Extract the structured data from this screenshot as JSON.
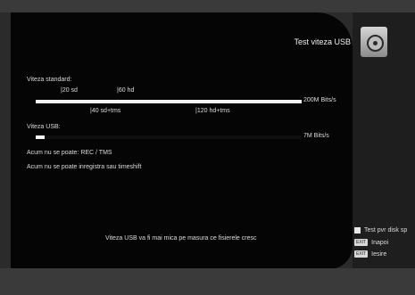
{
  "title": "Test viteza USB",
  "standard": {
    "label": "Viteza standard:",
    "marks_top": [
      "|20 sd",
      "|60 hd"
    ],
    "marks_bottom": [
      "|40 sd+tms",
      "|120 hd+tms"
    ],
    "value": "200M Bits/s",
    "fill_fraction": 1.0
  },
  "usb": {
    "label": "Viteza USB:",
    "value": "7M Bits/s",
    "fill_fraction": 0.035
  },
  "status_line1": "Acum nu se poate: REC / TMS",
  "status_line2": "Acum nu se poate inregistra sau timeshift",
  "footer_note": "Viteza USB va fi mai mica pe masura ce fisierele cresc",
  "legend": {
    "test_label": "Test pvr disk sp",
    "back_badge": "EXIT",
    "back_label": "Inapoi",
    "exit_badge": "EXIT",
    "exit_label": "Iesire"
  }
}
